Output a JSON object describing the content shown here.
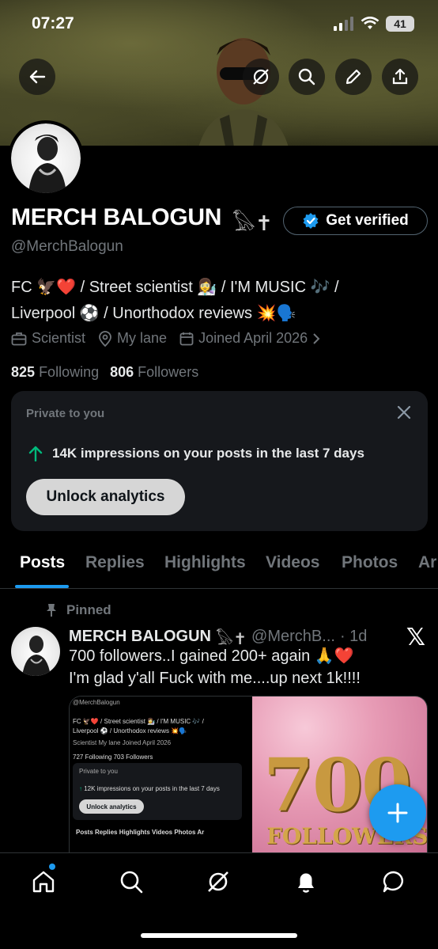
{
  "status_bar": {
    "time": "07:27",
    "battery": "41"
  },
  "profile": {
    "name": "MERCH BALOGUN",
    "name_emoji": "𓅃✝",
    "handle": "@MerchBalogun",
    "get_verified_label": "Get verified",
    "bio_line1": "FC 🦅❤️ / Street scientist 👩‍🔬 / I'M MUSIC 🎶 /",
    "bio_line2": "Liverpool ⚽ / Unorthodox reviews 💥🗣️",
    "occupation": "Scientist",
    "location": "My lane",
    "joined": "Joined April 2026",
    "following_count": "825",
    "following_label": "Following",
    "followers_count": "806",
    "followers_label": "Followers"
  },
  "private_card": {
    "title": "Private to you",
    "impressions": "14K impressions on your posts in the last 7 days",
    "unlock_label": "Unlock analytics"
  },
  "tabs": [
    "Posts",
    "Replies",
    "Highlights",
    "Videos",
    "Photos",
    "Ar"
  ],
  "post": {
    "pinned_label": "Pinned",
    "author": "MERCH BALOGUN",
    "author_emoji": "𓅃✝",
    "handle": "@MerchB...",
    "age": "· 1d",
    "text_line1": "700 followers..I gained 200+ again 🙏❤️",
    "text_line2": "I'm glad y'all Fuck with me....up next 1k!!!!",
    "media_right_number": "700",
    "media_right_caption": "FOLLOWERS"
  },
  "media_left": {
    "handle": "@MerchBalogun",
    "bio1": "FC 🦅❤️ / Street scientist 👩‍🔬 / I'M MUSIC 🎶 /",
    "bio2": "Liverpool ⚽ / Unorthodox reviews 💥🗣️",
    "meta": "Scientist   My lane   Joined April 2026",
    "follows": "727 Following  703 Followers",
    "private": "Private to you",
    "impressions": "12K impressions on your posts in the last 7 days",
    "unlock": "Unlock analytics",
    "tabs": "Posts   Replies   Highlights   Videos   Photos   Ar"
  },
  "colors": {
    "accent": "#1d9bf0",
    "secondary_text": "#71767b",
    "impressions_arrow": "#00ba7c"
  },
  "icons": [
    "back-icon",
    "grok-icon",
    "search-icon",
    "edit-icon",
    "share-icon",
    "verified-badge-icon",
    "briefcase-icon",
    "location-icon",
    "calendar-icon",
    "chevron-right-icon",
    "close-icon",
    "arrow-up-icon",
    "pin-icon",
    "x-logo-icon",
    "plus-icon",
    "home-icon",
    "search-nav-icon",
    "grok-nav-icon",
    "bell-icon",
    "message-icon"
  ]
}
